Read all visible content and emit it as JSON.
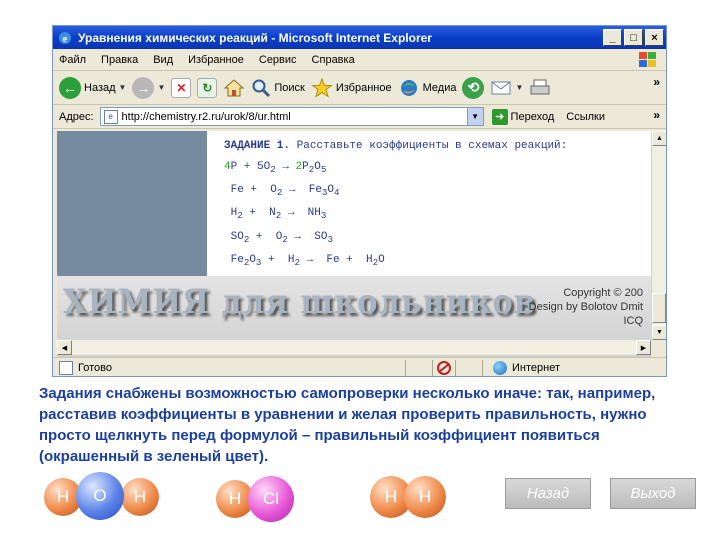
{
  "window": {
    "title": "Уравнения химических реакций - Microsoft Internet Explorer",
    "buttons": [
      "_",
      "□",
      "×"
    ]
  },
  "menu": [
    "Файл",
    "Правка",
    "Вид",
    "Избранное",
    "Сервис",
    "Справка"
  ],
  "toolbar": {
    "back": "Назад",
    "search": "Поиск",
    "favorites": "Избранное",
    "media": "Медиа"
  },
  "address": {
    "label": "Адрес:",
    "url": "http://chemistry.r2.ru/urok/8/ur.html",
    "go": "Переход",
    "links": "Ссылки"
  },
  "page": {
    "task_label": "ЗАДАНИЕ 1.",
    "task_text": " Расставьте коэффициенты в схемах реакций:",
    "logo": "ХИМИЯ для школьников",
    "credits": [
      "Copyright © 200",
      "Design by Bolotov Dmit",
      "ICQ"
    ]
  },
  "status": {
    "ready": "Готово",
    "zone": "Интернет"
  },
  "description": "Задания снабжены возможностью самопроверки несколько иначе: так, например, расставив коэффициенты в уравнении и желая проверить правильность, нужно просто щелкнуть перед формулой – правильный коэффициент появиться (окрашенный в зеленый цвет).",
  "molecules": {
    "h2o": [
      "H",
      "O",
      "H"
    ],
    "hcl": [
      "H",
      "Cl"
    ],
    "h2": [
      "H",
      "H"
    ]
  },
  "nav": {
    "back": "Назад",
    "exit": "Выход"
  },
  "colors": {
    "accent_text": "#1a3fa0",
    "correct_coefficient": "#2aa02a"
  }
}
